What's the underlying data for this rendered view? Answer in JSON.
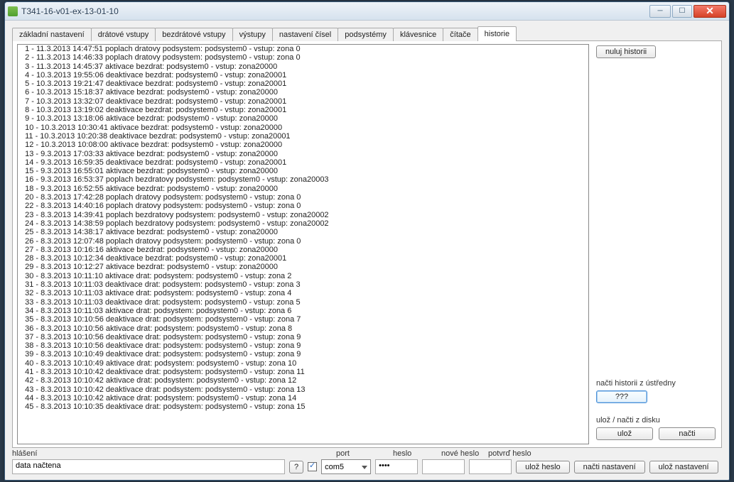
{
  "window": {
    "title": "T341-16-v01-ex-13-01-10"
  },
  "tabs": [
    {
      "label": "základní nastavení"
    },
    {
      "label": "drátové vstupy"
    },
    {
      "label": "bezdrátové vstupy"
    },
    {
      "label": "výstupy"
    },
    {
      "label": "nastavení čísel"
    },
    {
      "label": "podsystémy"
    },
    {
      "label": "klávesnice"
    },
    {
      "label": "čítače"
    },
    {
      "label": "historie"
    }
  ],
  "activeTab": 8,
  "side": {
    "clearHistory": "nuluj historii",
    "readLabel": "načti historii z ústředny",
    "readBtn": "???",
    "diskLabel": "ulož / načti z disku",
    "saveBtn": "ulož",
    "loadBtn": "načti"
  },
  "history": [
    "1 - 11.3.2013 14:47:51 poplach dratovy podsystem: podsystem0 - vstup: zona 0",
    "2 - 11.3.2013 14:46:33 poplach dratovy podsystem: podsystem0 - vstup: zona 0",
    "3 - 11.3.2013 14:45:37 aktivace bezdrat: podsystem0 - vstup: zona20000",
    "4 - 10.3.2013 19:55:06 deaktivace bezdrat: podsystem0 - vstup: zona20001",
    "5 - 10.3.2013 19:21:47 deaktivace bezdrat: podsystem0 - vstup: zona20001",
    "6 - 10.3.2013 15:18:37 aktivace bezdrat: podsystem0 - vstup: zona20000",
    "7 - 10.3.2013 13:32:07 deaktivace bezdrat: podsystem0 - vstup: zona20001",
    "8 - 10.3.2013 13:19:02 deaktivace bezdrat: podsystem0 - vstup: zona20001",
    "9 - 10.3.2013 13:18:06 aktivace bezdrat: podsystem0 - vstup: zona20000",
    "10 - 10.3.2013 10:30:41 aktivace bezdrat: podsystem0 - vstup: zona20000",
    "11 - 10.3.2013 10:20:38 deaktivace bezdrat: podsystem0 - vstup: zona20001",
    "12 - 10.3.2013 10:08:00 aktivace bezdrat: podsystem0 - vstup: zona20000",
    "13 - 9.3.2013 17:03:33 aktivace bezdrat: podsystem0 - vstup: zona20000",
    "14 - 9.3.2013 16:59:35 deaktivace bezdrat: podsystem0 - vstup: zona20001",
    "15 - 9.3.2013 16:55:01 aktivace bezdrat: podsystem0 - vstup: zona20000",
    "16 - 9.3.2013 16:53:37 poplach bezdratovy podsystem: podsystem0 - vstup: zona20003",
    "18 - 9.3.2013 16:52:55 aktivace bezdrat: podsystem0 - vstup: zona20000",
    "20 - 8.3.2013 17:42:28 poplach dratovy podsystem: podsystem0 - vstup: zona 0",
    "22 - 8.3.2013 14:40:16 poplach dratovy podsystem: podsystem0 - vstup: zona 0",
    "23 - 8.3.2013 14:39:41 poplach bezdratovy podsystem: podsystem0 - vstup: zona20002",
    "24 - 8.3.2013 14:38:59 poplach bezdratovy podsystem: podsystem0 - vstup: zona20002",
    "25 - 8.3.2013 14:38:17 aktivace bezdrat: podsystem0 - vstup: zona20000",
    "26 - 8.3.2013 12:07:48 poplach dratovy podsystem: podsystem0 - vstup: zona 0",
    "27 - 8.3.2013 10:16:16 aktivace bezdrat: podsystem0 - vstup: zona20000",
    "28 - 8.3.2013 10:12:34 deaktivace bezdrat: podsystem0 - vstup: zona20001",
    "29 - 8.3.2013 10:12:27 aktivace bezdrat: podsystem0 - vstup: zona20000",
    "30 - 8.3.2013 10:11:10 aktivace drat: podsystem: podsystem0 - vstup: zona 2",
    "31 - 8.3.2013 10:11:03 deaktivace drat: podsystem: podsystem0 - vstup: zona 3",
    "32 - 8.3.2013 10:11:03 aktivace drat: podsystem: podsystem0 - vstup: zona 4",
    "33 - 8.3.2013 10:11:03 deaktivace drat: podsystem: podsystem0 - vstup: zona 5",
    "34 - 8.3.2013 10:11:03 aktivace drat: podsystem: podsystem0 - vstup: zona 6",
    "35 - 8.3.2013 10:10:56 deaktivace drat: podsystem: podsystem0 - vstup: zona 7",
    "36 - 8.3.2013 10:10:56 aktivace drat: podsystem: podsystem0 - vstup: zona 8",
    "37 - 8.3.2013 10:10:56 deaktivace drat: podsystem: podsystem0 - vstup: zona 9",
    "38 - 8.3.2013 10:10:56 deaktivace drat: podsystem: podsystem0 - vstup: zona 9",
    "39 - 8.3.2013 10:10:49 deaktivace drat: podsystem: podsystem0 - vstup: zona 9",
    "40 - 8.3.2013 10:10:49 aktivace drat: podsystem: podsystem0 - vstup: zona 10",
    "41 - 8.3.2013 10:10:42 deaktivace drat: podsystem: podsystem0 - vstup: zona 11",
    "42 - 8.3.2013 10:10:42 aktivace drat: podsystem: podsystem0 - vstup: zona 12",
    "43 - 8.3.2013 10:10:42 deaktivace drat: podsystem: podsystem0 - vstup: zona 13",
    "44 - 8.3.2013 10:10:42 aktivace drat: podsystem: podsystem0 - vstup: zona 14",
    "45 - 8.3.2013 10:10:35 deaktivace drat: podsystem: podsystem0 - vstup: zona 15"
  ],
  "bottom": {
    "statusLabel": "hlášení",
    "statusText": "data načtena",
    "helpBtn": "?",
    "portLabel": "port",
    "portValue": "com5",
    "hesloLabel": "heslo",
    "hesloValue": "••••",
    "noveHesloLabel": "nové heslo",
    "potvrdHesloLabel": "potvrď heslo",
    "saveHeslo": "ulož heslo",
    "loadSettings": "načti nastavení",
    "saveSettings": "ulož nastavení"
  }
}
